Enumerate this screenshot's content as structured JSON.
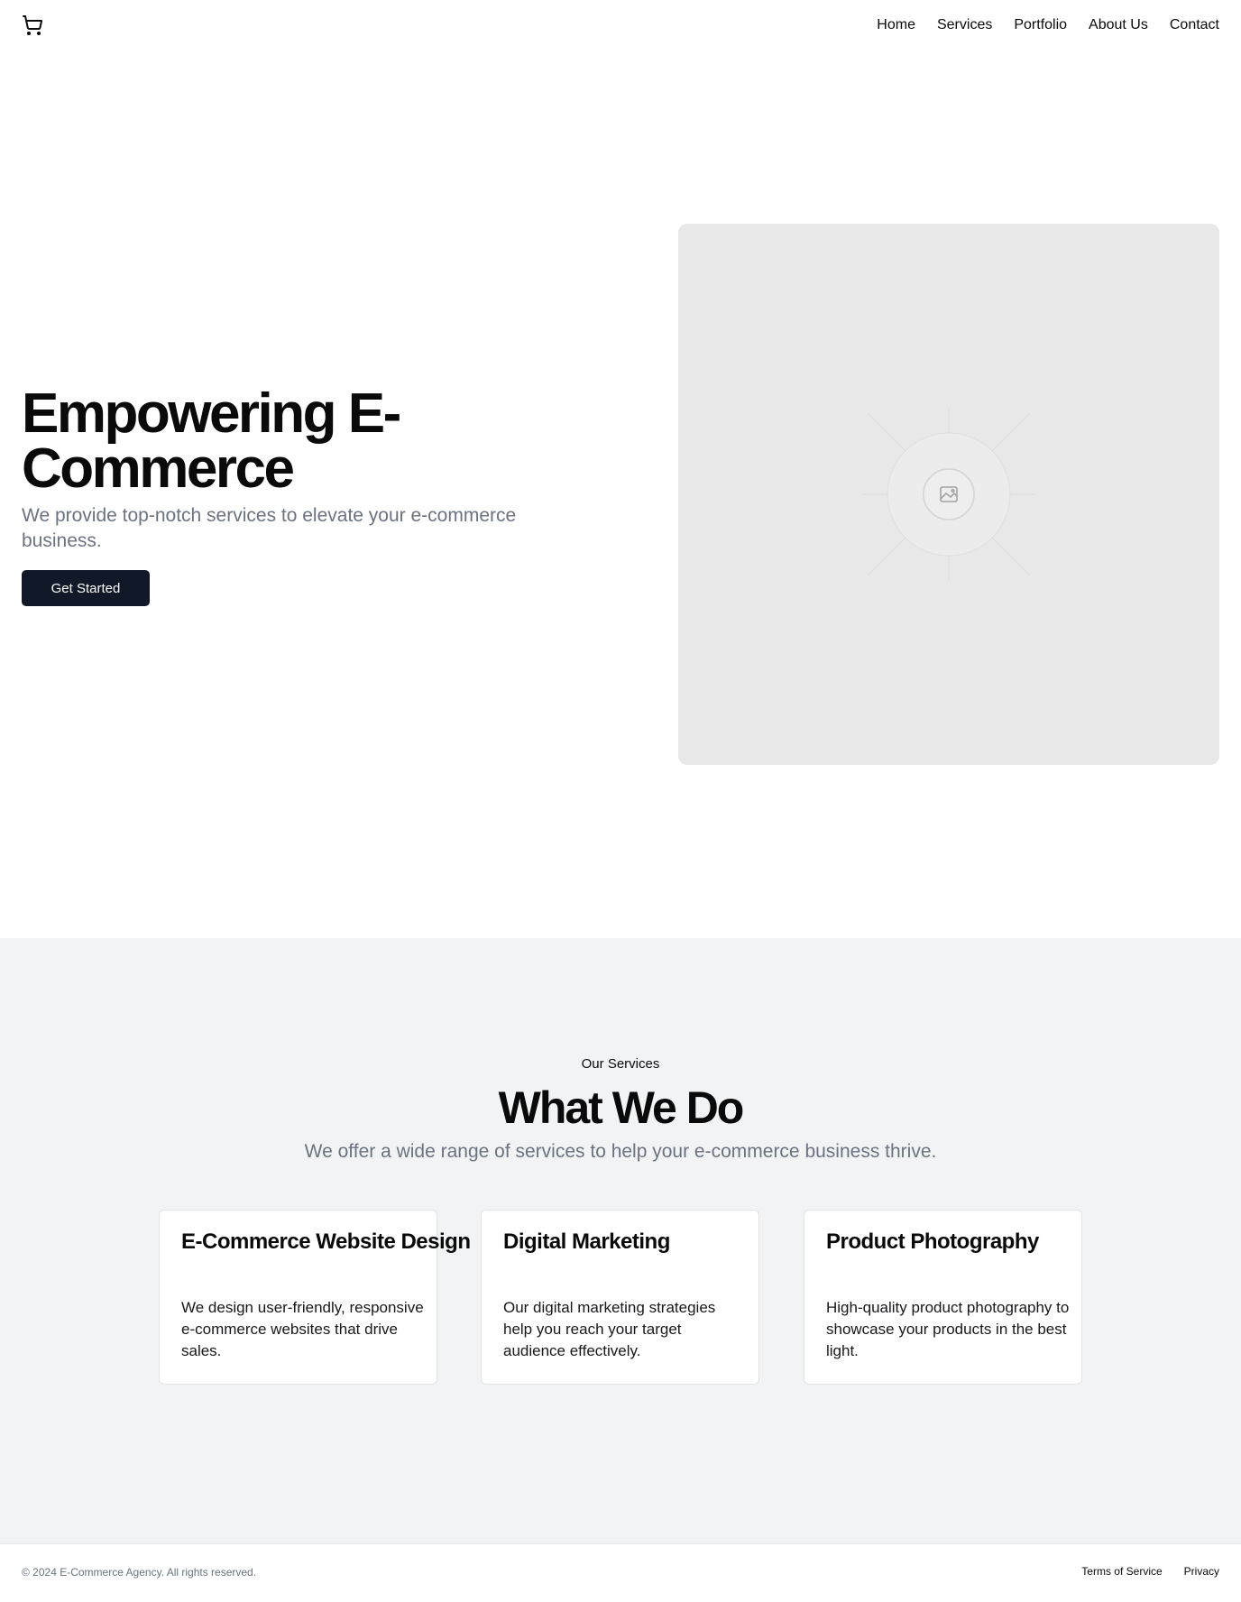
{
  "header": {
    "logo_icon": "shopping-cart-icon",
    "nav": [
      {
        "label": "Home"
      },
      {
        "label": "Services"
      },
      {
        "label": "Portfolio"
      },
      {
        "label": "About Us"
      },
      {
        "label": "Contact"
      }
    ]
  },
  "hero": {
    "title": "Empowering E-Commerce",
    "subtitle": "We provide top-notch services to elevate your e-commerce business.",
    "cta_label": "Get Started",
    "image_icon": "image-placeholder-icon"
  },
  "services": {
    "eyebrow": "Our Services",
    "title": "What We Do",
    "subtitle": "We offer a wide range of services to help your e-commerce business thrive.",
    "cards": [
      {
        "title": "E-Commerce Website Design",
        "text": "We design user-friendly, responsive e-commerce websites that drive sales."
      },
      {
        "title": "Digital Marketing",
        "text": "Our digital marketing strategies help you reach your target audience effectively."
      },
      {
        "title": "Product Photography",
        "text": "High-quality product photography to showcase your products in the best light."
      }
    ]
  },
  "footer": {
    "copyright": "© 2024 E-Commerce Agency. All rights reserved.",
    "links": [
      {
        "label": "Terms of Service"
      },
      {
        "label": "Privacy"
      }
    ]
  },
  "colors": {
    "primary_button": "#111827",
    "muted_text": "#6b7280",
    "section_bg": "#f2f3f5",
    "image_placeholder_bg": "#e8e8e8"
  }
}
